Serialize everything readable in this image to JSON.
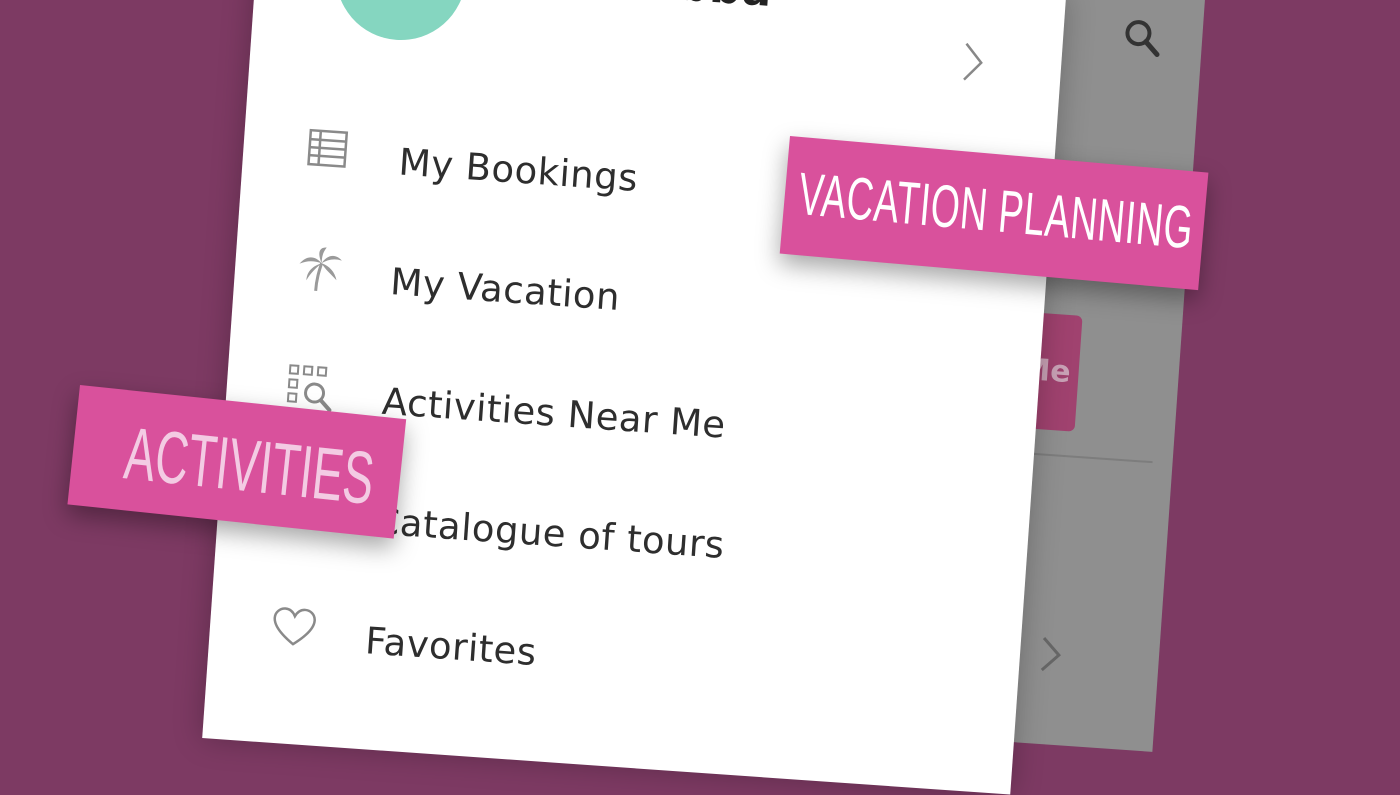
{
  "profile": {
    "name": "Bob Bubba"
  },
  "menu": {
    "items": [
      {
        "label": "My Bookings",
        "icon": "table-icon"
      },
      {
        "label": "My Vacation",
        "icon": "palm-tree-icon"
      },
      {
        "label": "Activities Near Me",
        "icon": "grid-search-icon"
      },
      {
        "label": "Catalogue of tours",
        "icon": "catalogue-icon"
      },
      {
        "label": "Favorites",
        "icon": "heart-icon"
      }
    ]
  },
  "background": {
    "button_text": "Me"
  },
  "stickers": {
    "vacation": "VACATION PLANNING",
    "activities": "ACTIVITIES"
  },
  "colors": {
    "page_background": "#7d3a63",
    "sticker_pink": "#d9519c",
    "avatar_mint": "#85d6c0",
    "backdrop_grey": "#8f8f8f"
  }
}
